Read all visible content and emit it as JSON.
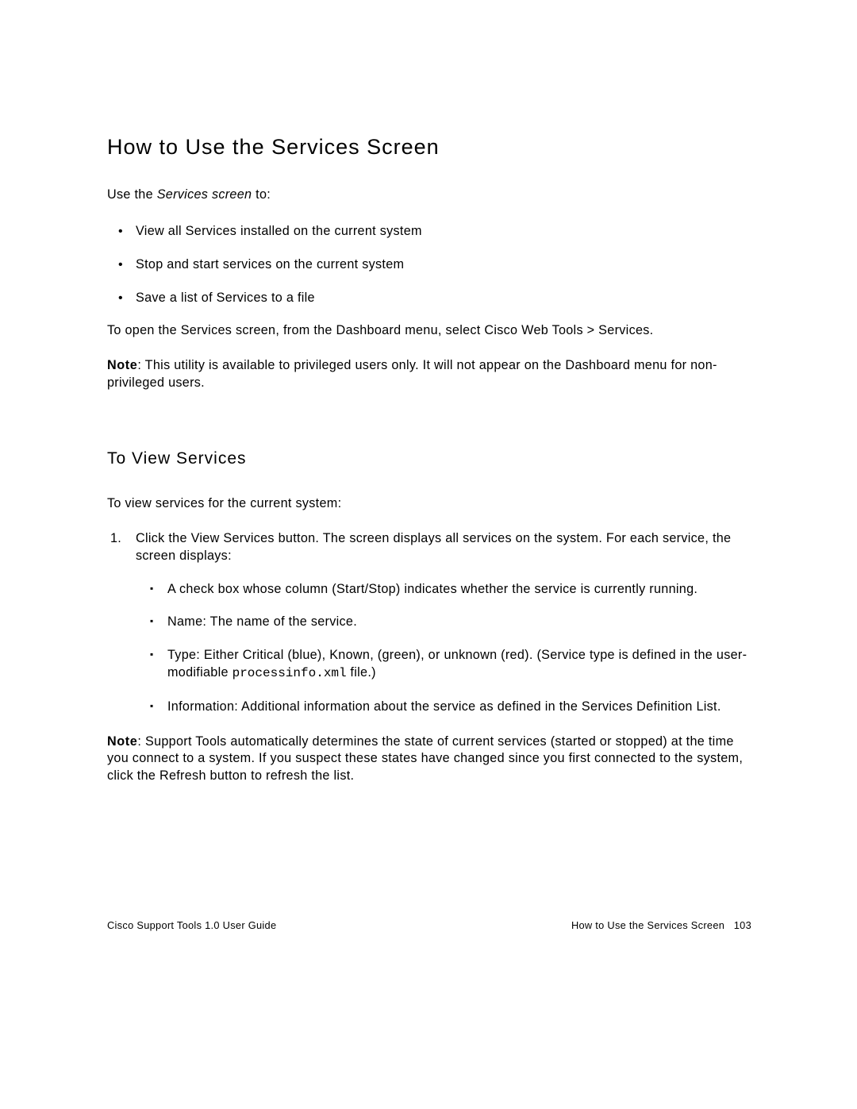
{
  "heading": "How to Use the Services Screen",
  "intro_prefix": "Use the ",
  "intro_em": "Services screen",
  "intro_suffix": " to:",
  "bullets": [
    "View all Services installed on the current system",
    "Stop and start services on the current system",
    "Save a list of Services to a file"
  ],
  "open_para": "To open the Services screen, from the Dashboard menu, select Cisco Web Tools > Services.",
  "note1_label": "Note",
  "note1_body": ": This utility is available to privileged users only. It will not appear on the Dashboard menu for non-privileged users.",
  "subheading": "To View Services",
  "subintro": "To view services for the current system:",
  "step1_num": "1.",
  "step1_text": "Click the View Services button. The screen displays all services on the system. For each service, the screen displays:",
  "sub_items": {
    "a": "A check box whose column (Start/Stop) indicates whether the service is currently running.",
    "b": "Name: The name of the service.",
    "c_prefix": "Type: Either Critical (blue), Known, (green), or unknown (red). (Service type is defined in the user-modifiable ",
    "c_mono": "processinfo.xml",
    "c_suffix": " file.)",
    "d": "Information: Additional information about the service as defined in the Services Definition List."
  },
  "note2_label": "Note",
  "note2_body": ": Support Tools automatically determines the state of current services (started or stopped) at the time you connect to a system. If you suspect these states have changed since you first connected to the system, click the Refresh button to refresh the list.",
  "footer": {
    "left": "Cisco Support Tools 1.0 User Guide",
    "right_title": "How to Use the Services Screen",
    "right_page": "103"
  }
}
